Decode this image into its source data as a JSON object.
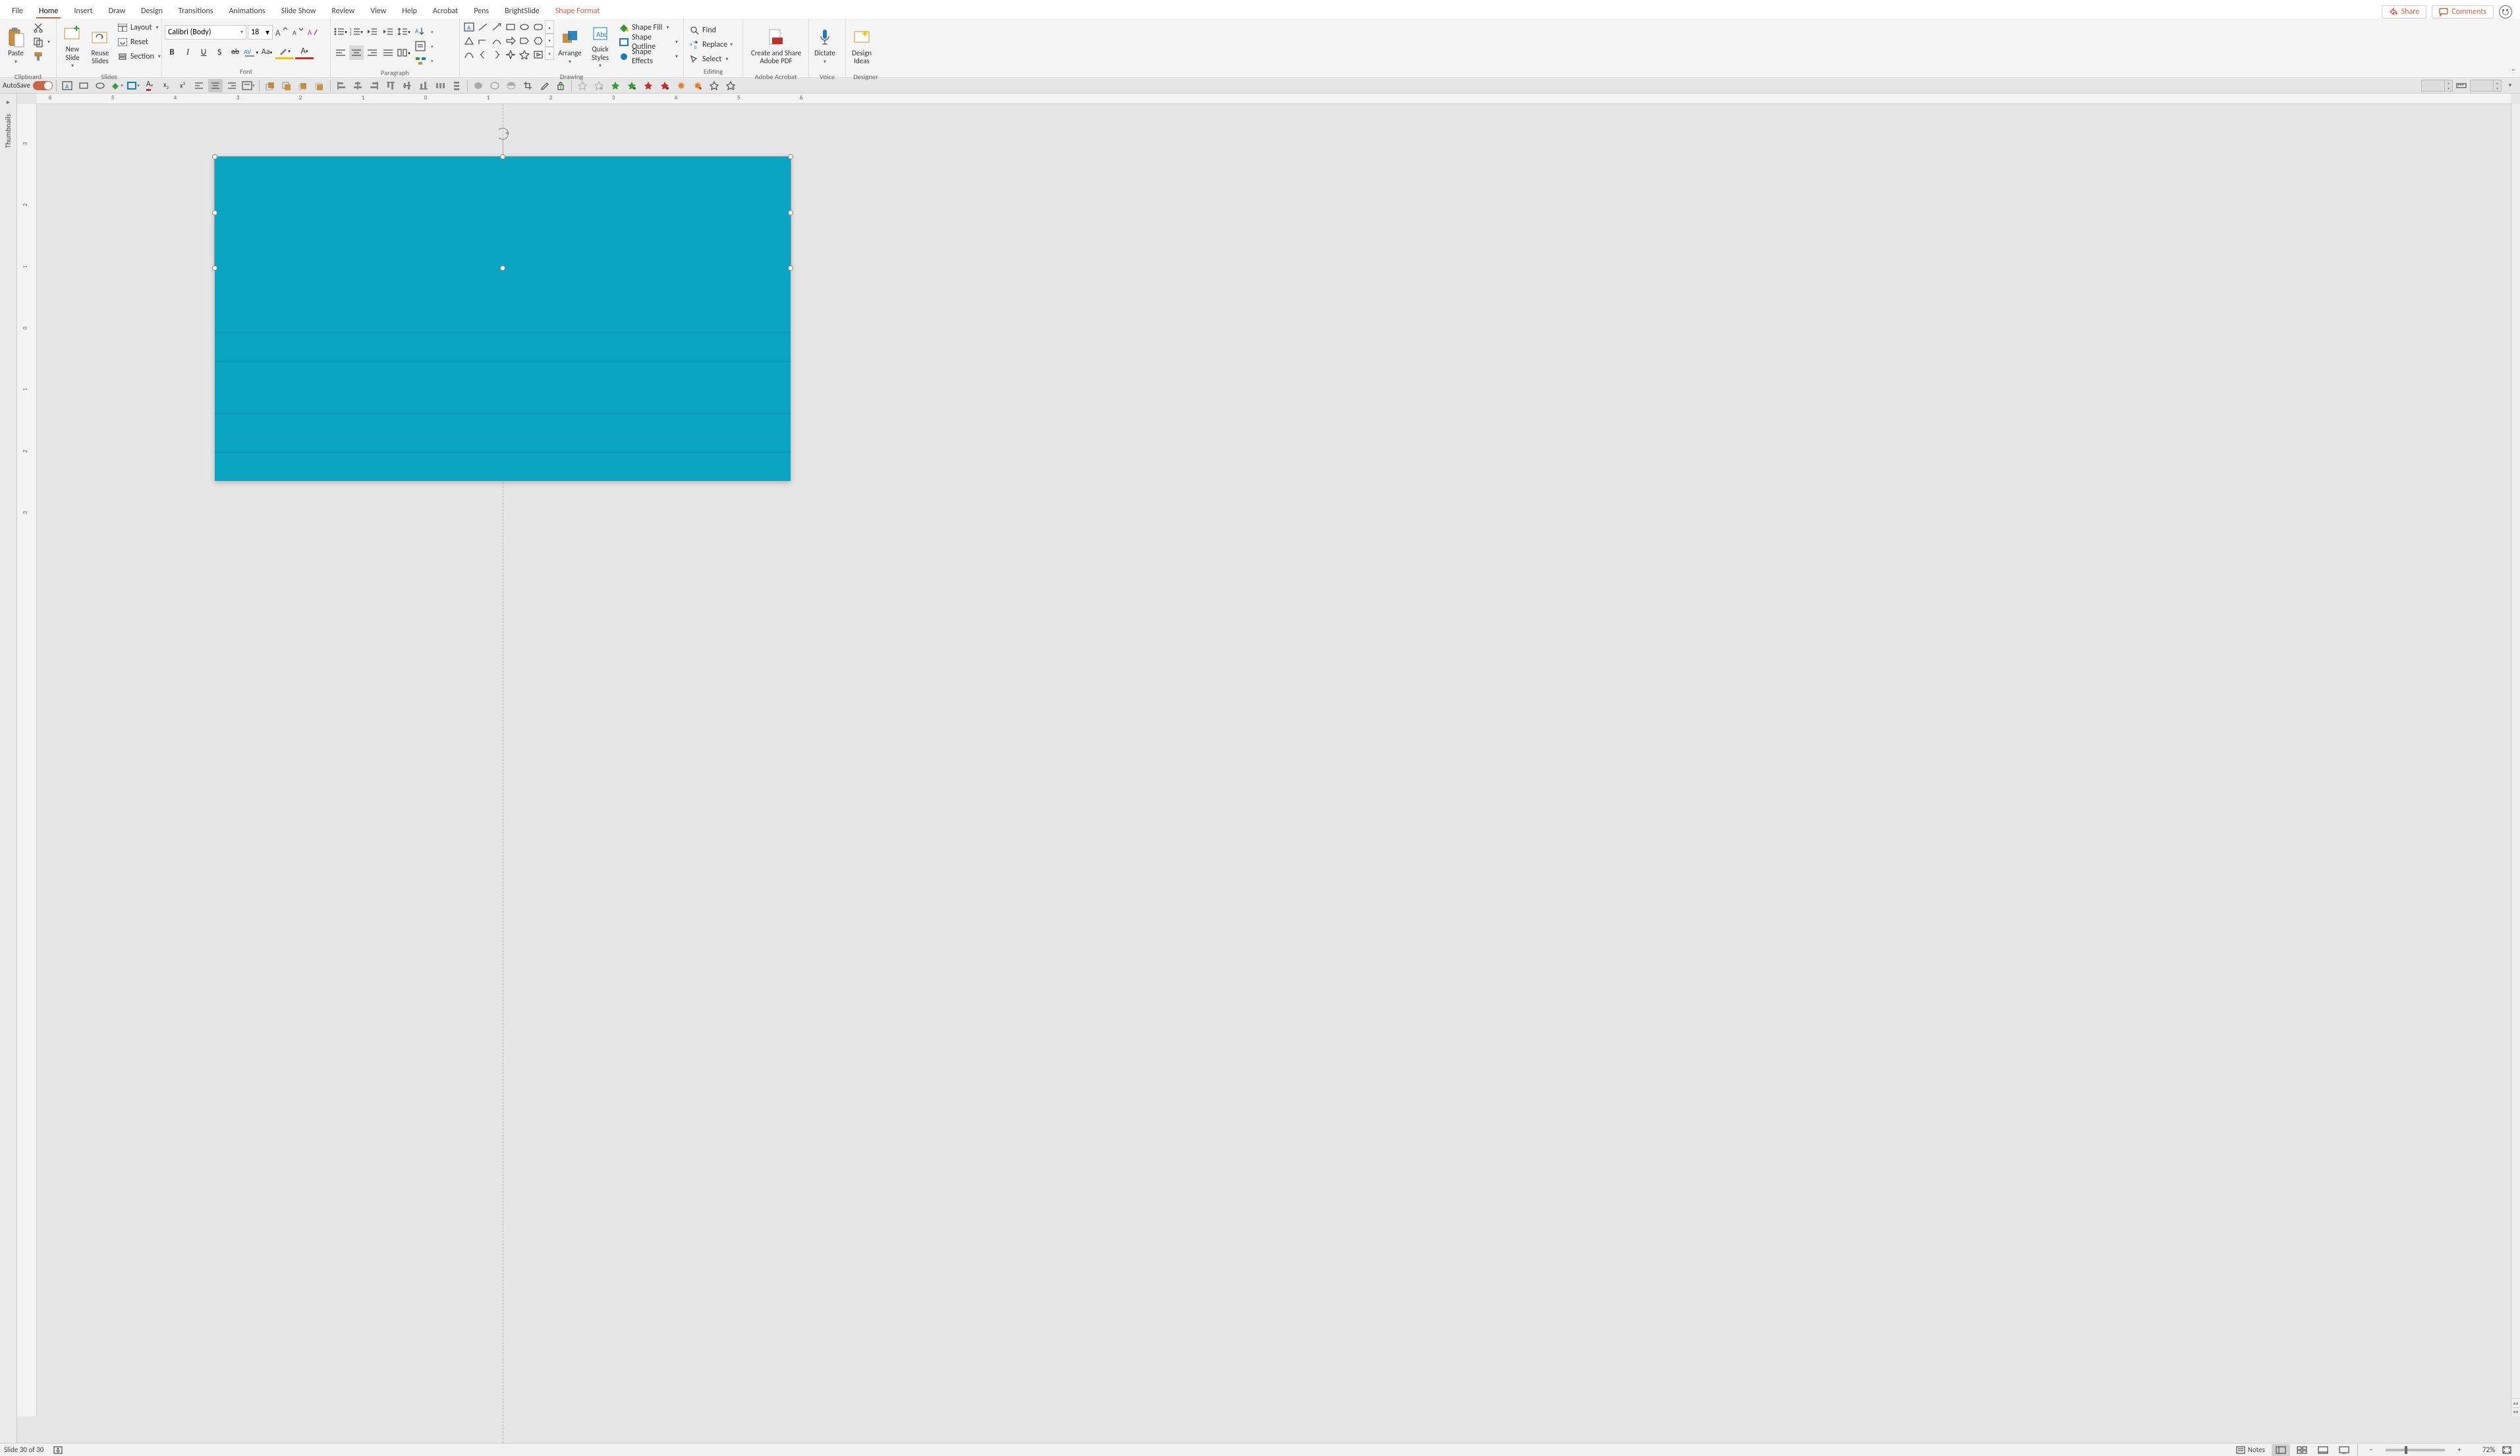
{
  "tabs": {
    "file": "File",
    "home": "Home",
    "insert": "Insert",
    "draw": "Draw",
    "design": "Design",
    "transitions": "Transitions",
    "animations": "Animations",
    "slideshow": "Slide Show",
    "review": "Review",
    "view": "View",
    "help": "Help",
    "acrobat": "Acrobat",
    "pens": "Pens",
    "brightslide": "BrightSlide",
    "shapeformat": "Shape Format"
  },
  "top_right": {
    "share": "Share",
    "comments": "Comments"
  },
  "ribbon": {
    "clipboard": {
      "paste": "Paste",
      "label": "Clipboard"
    },
    "slides": {
      "new": "New\nSlide",
      "reuse": "Reuse\nSlides",
      "layout": "Layout",
      "reset": "Reset",
      "section": "Section",
      "label": "Slides"
    },
    "font": {
      "name": "Calibri (Body)",
      "size": "18",
      "label": "Font"
    },
    "paragraph": {
      "label": "Paragraph"
    },
    "drawing": {
      "arrange": "Arrange",
      "quick": "Quick\nStyles",
      "fill": "Shape Fill",
      "outline": "Shape Outline",
      "effects": "Shape Effects",
      "label": "Drawing"
    },
    "editing": {
      "find": "Find",
      "replace": "Replace",
      "select": "Select",
      "label": "Editing"
    },
    "adobe": {
      "create": "Create and Share\nAdobe PDF",
      "label": "Adobe Acrobat"
    },
    "voice": {
      "dictate": "Dictate",
      "label": "Voice"
    },
    "designer": {
      "ideas": "Design\nIdeas",
      "label": "Designer"
    }
  },
  "qat2": {
    "autosave": "AutoSave"
  },
  "thumbnails_label": "Thumbnails",
  "hruler_ticks": [
    "6",
    "5",
    "4",
    "3",
    "2",
    "1",
    "0",
    "1",
    "2",
    "3",
    "4",
    "5",
    "6"
  ],
  "vruler_ticks": [
    "3",
    "2",
    "1",
    "0",
    "1",
    "2",
    "3"
  ],
  "status": {
    "slide_info": "Slide 30 of 30",
    "notes": "Notes",
    "zoom": "72%"
  },
  "colors": {
    "shape_fill": "#0aa5c2",
    "accent": "#c8654a"
  }
}
